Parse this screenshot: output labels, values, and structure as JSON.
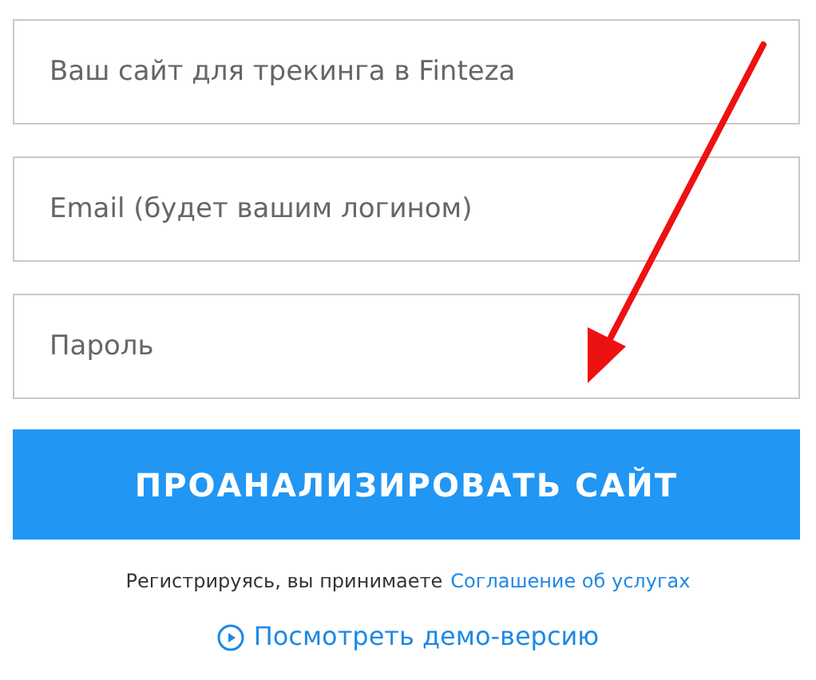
{
  "fields": [
    {
      "placeholder": "Ваш сайт для трекинга в Finteza"
    },
    {
      "placeholder": "Email (будет вашим логином)"
    },
    {
      "placeholder": "Пароль"
    }
  ],
  "submit_button": "ПРОАНАЛИЗИРОВАТЬ САЙТ",
  "terms": {
    "text": "Регистрируясь, вы принимаете",
    "link": "Соглашение об услугах"
  },
  "demo_link": "Посмотреть демо-версию"
}
